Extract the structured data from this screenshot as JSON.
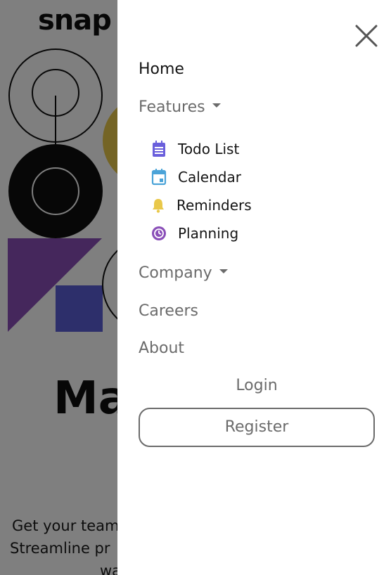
{
  "app": {
    "logo_text": "snap"
  },
  "hero": {
    "title_partial": "Ma",
    "line1": "Get your team",
    "line2": "Streamline pr",
    "line3": "wa"
  },
  "drawer": {
    "close_icon": "close-icon",
    "nav": {
      "home": "Home",
      "features": "Features",
      "features_items": [
        {
          "label": "Todo List",
          "icon": "todo-list-icon",
          "color": "#6a5fdc"
        },
        {
          "label": "Calendar",
          "icon": "calendar-icon",
          "color": "#4aa3d8"
        },
        {
          "label": "Reminders",
          "icon": "bell-icon",
          "color": "#e9c84a"
        },
        {
          "label": "Planning",
          "icon": "planning-icon",
          "color": "#8a4fb8"
        }
      ],
      "company": "Company",
      "careers": "Careers",
      "about": "About"
    },
    "login_label": "Login",
    "register_label": "Register"
  },
  "colors": {
    "overlay": "rgba(0,0,0,0.5)",
    "text_dark": "#141414",
    "text_muted": "#6b6b6b",
    "art_yellow": "#e9c84a",
    "art_purple": "#8a4fb8",
    "art_blue": "#5b5fd6"
  }
}
